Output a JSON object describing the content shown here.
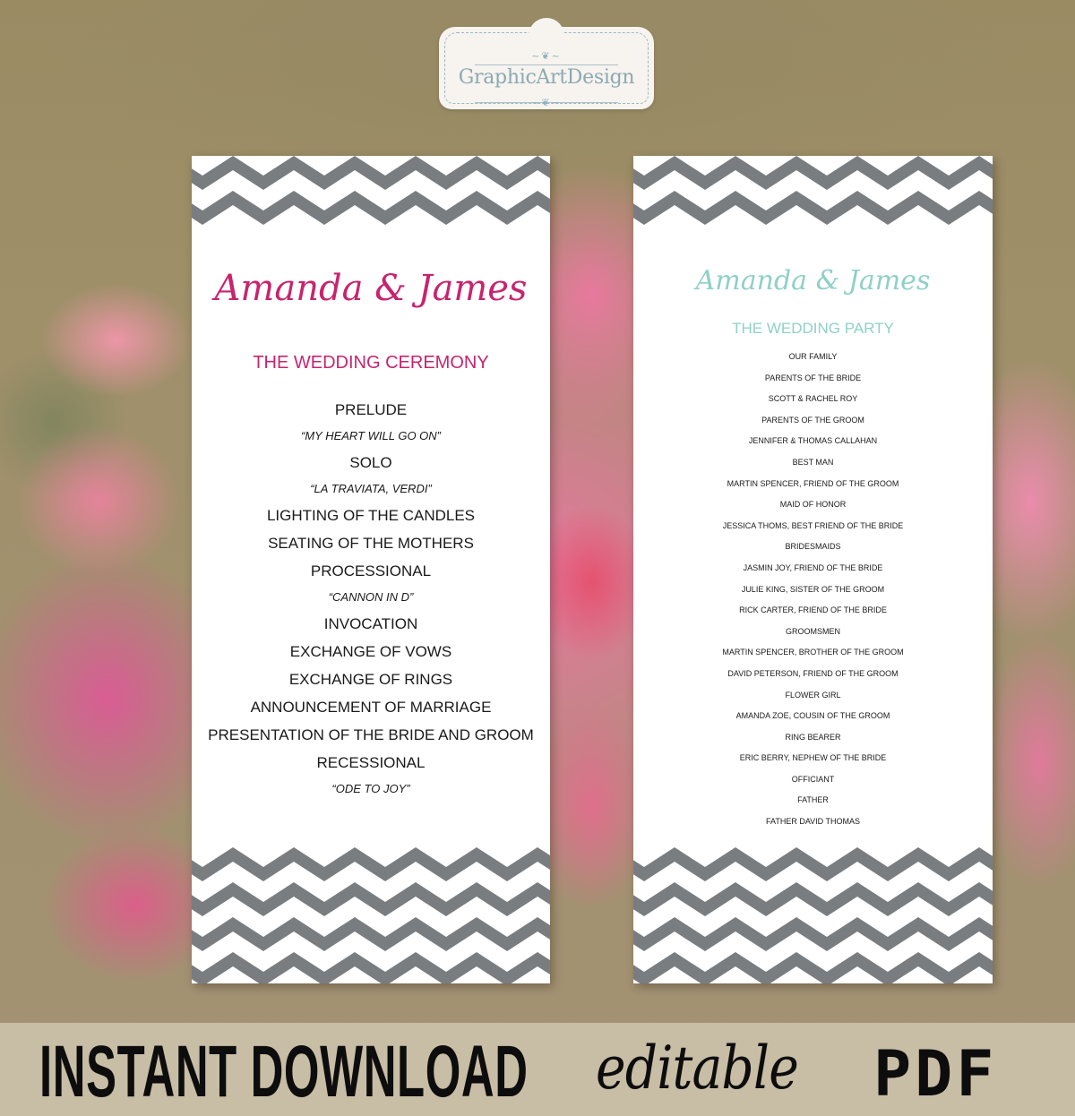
{
  "logo": {
    "brand": "GraphicArtDesign",
    "ornament": "~❦~"
  },
  "colors": {
    "ceremony_accent": "#c8246e",
    "party_accent": "#8fd0c8",
    "chevron_gray": "#7a7d80",
    "text": "#1a1a1a"
  },
  "ceremony_card": {
    "names": "Amanda & James",
    "title": "THE WEDDING CEREMONY",
    "program": [
      {
        "text": "PRELUDE",
        "type": "event"
      },
      {
        "text": "“MY HEART WILL GO ON”",
        "type": "song"
      },
      {
        "text": "SOLO",
        "type": "event"
      },
      {
        "text": "“LA TRAVIATA, VERDI”",
        "type": "song"
      },
      {
        "text": "LIGHTING OF THE CANDLES",
        "type": "event"
      },
      {
        "text": "SEATING OF THE MOTHERS",
        "type": "event"
      },
      {
        "text": "PROCESSIONAL",
        "type": "event"
      },
      {
        "text": "“CANNON IN D”",
        "type": "song"
      },
      {
        "text": "INVOCATION",
        "type": "event"
      },
      {
        "text": "EXCHANGE OF VOWS",
        "type": "event"
      },
      {
        "text": "EXCHANGE OF RINGS",
        "type": "event"
      },
      {
        "text": "ANNOUNCEMENT OF MARRIAGE",
        "type": "event"
      },
      {
        "text": "PRESENTATION OF THE BRIDE AND GROOM",
        "type": "event"
      },
      {
        "text": "RECESSIONAL",
        "type": "event"
      },
      {
        "text": "“ODE TO JOY”",
        "type": "song"
      }
    ]
  },
  "party_card": {
    "names": "Amanda & James",
    "title": "THE WEDDING PARTY",
    "members": [
      "OUR FAMILY",
      "PARENTS OF THE BRIDE",
      "SCOTT & RACHEL ROY",
      "PARENTS OF THE GROOM",
      "JENNIFER & THOMAS CALLAHAN",
      "BEST MAN",
      "MARTIN SPENCER, FRIEND OF THE GROOM",
      "MAID OF HONOR",
      "JESSICA  THOMS, BEST FRIEND OF THE BRIDE",
      "BRIDESMAIDS",
      "JASMIN JOY, FRIEND OF THE BRIDE",
      "JULIE KING, SISTER OF THE GROOM",
      "RICK CARTER, FRIEND OF THE BRIDE",
      "GROOMSMEN",
      "MARTIN  SPENCER, BROTHER OF THE GROOM",
      "DAVID PETERSON, FRIEND OF THE GROOM",
      "FLOWER GIRL",
      "AMANDA ZOE, COUSIN OF THE GROOM",
      "RING BEARER",
      "ERIC BERRY, NEPHEW OF THE BRIDE",
      "OFFICIANT",
      "FATHER",
      "FATHER DAVID THOMAS"
    ]
  },
  "banner": {
    "bold": "INSTANT DOWNLOAD",
    "italic": "editable",
    "format": "PDF"
  }
}
